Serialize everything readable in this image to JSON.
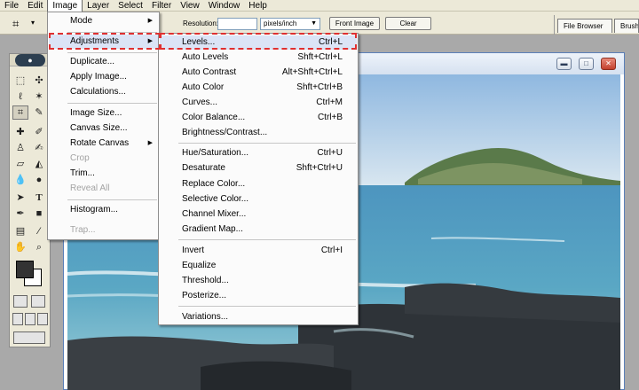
{
  "menubar": {
    "items": [
      "File",
      "Edit",
      "Image",
      "Layer",
      "Select",
      "Filter",
      "View",
      "Window",
      "Help"
    ],
    "active_index": 2
  },
  "options_bar": {
    "crop_icon": "crop-icon",
    "resolution_label": "Resolution:",
    "resolution_value": "",
    "units_value": "pixels/inch",
    "front_image_label": "Front Image",
    "clear_label": "Clear",
    "palette_tabs": [
      "File Browser",
      "Brush"
    ]
  },
  "image_menu": {
    "items": [
      {
        "label": "Mode",
        "submenu": true,
        "enabled": true
      },
      {
        "label": "Adjustments",
        "submenu": true,
        "enabled": true,
        "highlighted": true
      },
      {
        "separator": true
      },
      {
        "label": "Duplicate...",
        "enabled": true
      },
      {
        "label": "Apply Image...",
        "enabled": true
      },
      {
        "label": "Calculations...",
        "enabled": true
      },
      {
        "separator": true
      },
      {
        "label": "Image Size...",
        "enabled": true
      },
      {
        "label": "Canvas Size...",
        "enabled": true
      },
      {
        "label": "Rotate Canvas",
        "submenu": true,
        "enabled": true
      },
      {
        "label": "Crop",
        "enabled": false
      },
      {
        "label": "Trim...",
        "enabled": true
      },
      {
        "label": "Reveal All",
        "enabled": false
      },
      {
        "separator": true
      },
      {
        "label": "Histogram...",
        "enabled": true
      },
      {
        "separator": true
      },
      {
        "label": "Trap...",
        "enabled": false
      }
    ]
  },
  "adjustments_menu": {
    "items": [
      {
        "label": "Levels...",
        "shortcut": "Ctrl+L",
        "highlighted": true
      },
      {
        "label": "Auto Levels",
        "shortcut": "Shft+Ctrl+L"
      },
      {
        "label": "Auto Contrast",
        "shortcut": "Alt+Shft+Ctrl+L"
      },
      {
        "label": "Auto Color",
        "shortcut": "Shft+Ctrl+B"
      },
      {
        "label": "Curves...",
        "shortcut": "Ctrl+M"
      },
      {
        "label": "Color Balance...",
        "shortcut": "Ctrl+B"
      },
      {
        "label": "Brightness/Contrast...",
        "shortcut": ""
      },
      {
        "separator": true
      },
      {
        "label": "Hue/Saturation...",
        "shortcut": "Ctrl+U"
      },
      {
        "label": "Desaturate",
        "shortcut": "Shft+Ctrl+U"
      },
      {
        "label": "Replace Color...",
        "shortcut": ""
      },
      {
        "label": "Selective Color...",
        "shortcut": ""
      },
      {
        "label": "Channel Mixer...",
        "shortcut": ""
      },
      {
        "label": "Gradient Map...",
        "shortcut": ""
      },
      {
        "separator": true
      },
      {
        "label": "Invert",
        "shortcut": "Ctrl+I"
      },
      {
        "label": "Equalize",
        "shortcut": ""
      },
      {
        "label": "Threshold...",
        "shortcut": ""
      },
      {
        "label": "Posterize...",
        "shortcut": ""
      },
      {
        "separator": true
      },
      {
        "label": "Variations...",
        "shortcut": ""
      }
    ]
  },
  "toolbox": {
    "foreground_color": "#333333",
    "background_color": "#ffffff",
    "tools": [
      "marquee-icon",
      "move-icon",
      "lasso-icon",
      "magic-wand-icon",
      "crop-icon",
      "slice-icon",
      "healing-brush-icon",
      "brush-icon",
      "clone-stamp-icon",
      "history-brush-icon",
      "eraser-icon",
      "paint-bucket-icon",
      "blur-icon",
      "dodge-icon",
      "path-selection-icon",
      "type-icon",
      "pen-icon",
      "shape-icon",
      "notes-icon",
      "eyedropper-icon",
      "hand-icon",
      "zoom-icon"
    ]
  },
  "document": {
    "window_buttons": [
      "minimize-icon",
      "maximize-icon",
      "close-icon"
    ],
    "colors": {
      "sky_top": "#8fb8e0",
      "sky_bottom": "#d8e6f0",
      "sea": "#5aa7c4",
      "rocks": "#2e3338",
      "island": "#5a7a4a"
    }
  }
}
